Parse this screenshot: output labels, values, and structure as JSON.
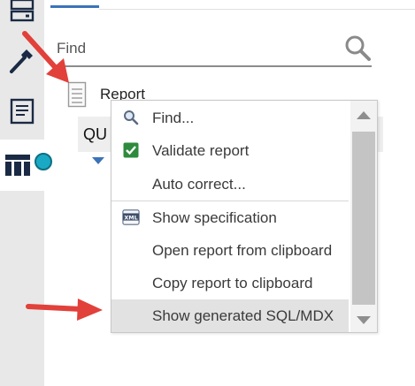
{
  "colors": {
    "accent": "#3b73b9",
    "arrow": "#e2403a",
    "teal": "#1aa9c4",
    "validate_green": "#2e8b3d"
  },
  "rail": {
    "items": [
      {
        "icon": "server-icon"
      },
      {
        "icon": "hammer-icon"
      },
      {
        "icon": "document-icon"
      },
      {
        "icon": "table-columns-icon",
        "active": true
      }
    ]
  },
  "search": {
    "placeholder": "Find",
    "value": "",
    "icon": "search-icon"
  },
  "tree": {
    "root_label": "Report",
    "root_icon": "document-icon",
    "child_label": "QU"
  },
  "context_menu": {
    "items": [
      {
        "label": "Find...",
        "icon": "magnifier-icon"
      },
      {
        "label": "Validate report",
        "icon": "check-icon"
      },
      {
        "label": "Auto correct...",
        "icon": ""
      },
      {
        "label": "Show specification",
        "icon": "xml-icon"
      },
      {
        "label": "Open report from clipboard",
        "icon": ""
      },
      {
        "label": "Copy report to clipboard",
        "icon": ""
      },
      {
        "label": "Show generated SQL/MDX",
        "icon": "",
        "highlighted": true
      }
    ]
  }
}
